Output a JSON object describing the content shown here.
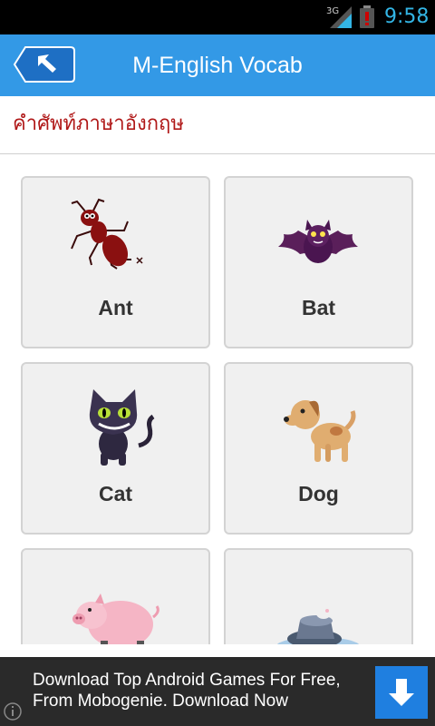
{
  "status_bar": {
    "network": "3G",
    "time": "9:58",
    "colors": {
      "time": "#33b5e5",
      "battery_alert": "#cc0000"
    }
  },
  "action_bar": {
    "title": "M-English Vocab",
    "back_icon": "back-arrow-icon",
    "color": "#3399e6"
  },
  "section": {
    "title": "คำศัพท์ภาษาอังกฤษ",
    "color": "#b01818"
  },
  "tiles": [
    {
      "label": "Ant",
      "icon": "ant-icon"
    },
    {
      "label": "Bat",
      "icon": "bat-icon"
    },
    {
      "label": "Cat",
      "icon": "cat-icon"
    },
    {
      "label": "Dog",
      "icon": "dog-icon"
    },
    {
      "label": "",
      "icon": "pig-icon"
    },
    {
      "label": "",
      "icon": "hat-icon"
    }
  ],
  "ad": {
    "text": "Download Top Android Games For Free, From Mobogenie. Download Now",
    "button_icon": "download-arrow-icon",
    "info_icon": "info-icon"
  }
}
